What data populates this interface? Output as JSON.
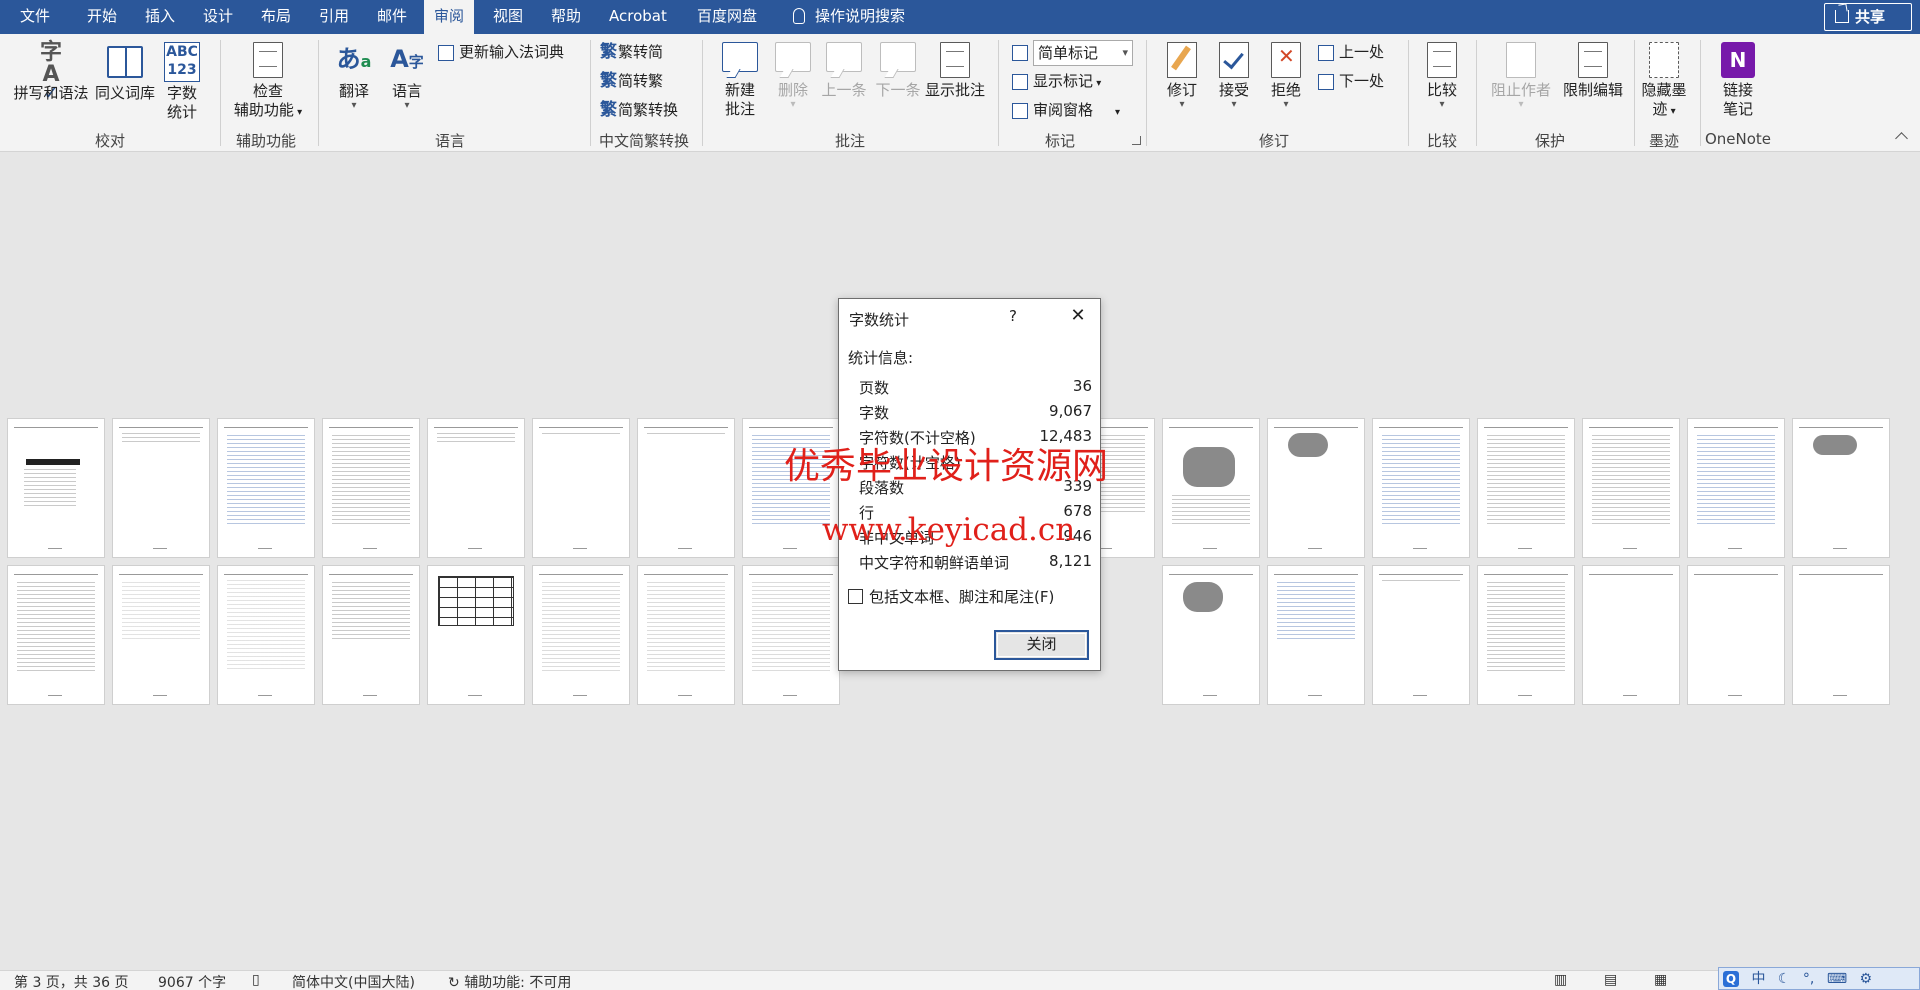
{
  "menu": {
    "tabs": [
      "文件",
      "开始",
      "插入",
      "设计",
      "布局",
      "引用",
      "邮件",
      "审阅",
      "视图",
      "帮助",
      "Acrobat",
      "百度网盘"
    ],
    "active_tab": "审阅",
    "tell_me": "操作说明搜索",
    "share": "共享"
  },
  "ribbon": {
    "proofing": {
      "spelling": "拼写和语法",
      "thesaurus": "同义词库",
      "wordcount_1": "字数",
      "wordcount_2": "统计",
      "group": "校对"
    },
    "accessibility": {
      "check_1": "检查",
      "check_2": "辅助功能",
      "group": "辅助功能"
    },
    "language": {
      "translate": "翻译",
      "language": "语言",
      "update_ime": "更新输入法词典",
      "group": "语言"
    },
    "chinese": {
      "to_simplified": "繁转简",
      "to_traditional": "简转繁",
      "convert": "简繁转换",
      "group": "中文简繁转换"
    },
    "comments": {
      "new_1": "新建",
      "new_2": "批注",
      "delete": "删除",
      "previous": "上一条",
      "next": "下一条",
      "show": "显示批注",
      "group": "批注"
    },
    "tracking": {
      "markup": "简单标记",
      "show_markup": "显示标记",
      "review_pane": "审阅窗格",
      "group": "标记"
    },
    "changes": {
      "track": "修订",
      "accept": "接受",
      "reject": "拒绝",
      "previous": "上一处",
      "next": "下一处",
      "group": "修订"
    },
    "compare": {
      "compare": "比较",
      "group": "比较"
    },
    "protect": {
      "block_authors": "阻止作者",
      "restrict": "限制编辑",
      "group": "保护"
    },
    "ink": {
      "hide_1": "隐藏墨",
      "hide_2": "迹",
      "group": "墨迹"
    },
    "onenote": {
      "link_1": "链接",
      "link_2": "笔记",
      "group": "OneNote"
    }
  },
  "dialog": {
    "title": "字数统计",
    "help": "?",
    "stats_label": "统计信息:",
    "stats": [
      {
        "label": "页数",
        "value": "36"
      },
      {
        "label": "字数",
        "value": "9,067"
      },
      {
        "label": "字符数(不计空格)",
        "value": "12,483"
      },
      {
        "label": "字符数(计空格)",
        "value": ""
      },
      {
        "label": "段落数",
        "value": "339"
      },
      {
        "label": "行",
        "value": "678"
      },
      {
        "label": "非中文单词",
        "value": "946"
      },
      {
        "label": "中文字符和朝鲜语单词",
        "value": "8,121"
      }
    ],
    "include_label": "包括文本框、脚注和尾注(F)",
    "close_button": "关闭"
  },
  "watermark": {
    "line1": "优秀毕业设计资源网",
    "line2": "www.keyicad.cn",
    "color": "#e0201a"
  },
  "statusbar": {
    "page": "第 3 页，共 36 页",
    "words": "9067 个字",
    "language": "简体中文(中国大陆)",
    "accessibility": "辅助功能: 不可用"
  },
  "ime": {
    "items": [
      "中",
      "☾",
      "°,",
      "⌨",
      "⚙"
    ]
  },
  "colors": {
    "ribbon_blue": "#2b579a",
    "background": "#e6e6e6",
    "watermark_red": "#e0201a"
  }
}
